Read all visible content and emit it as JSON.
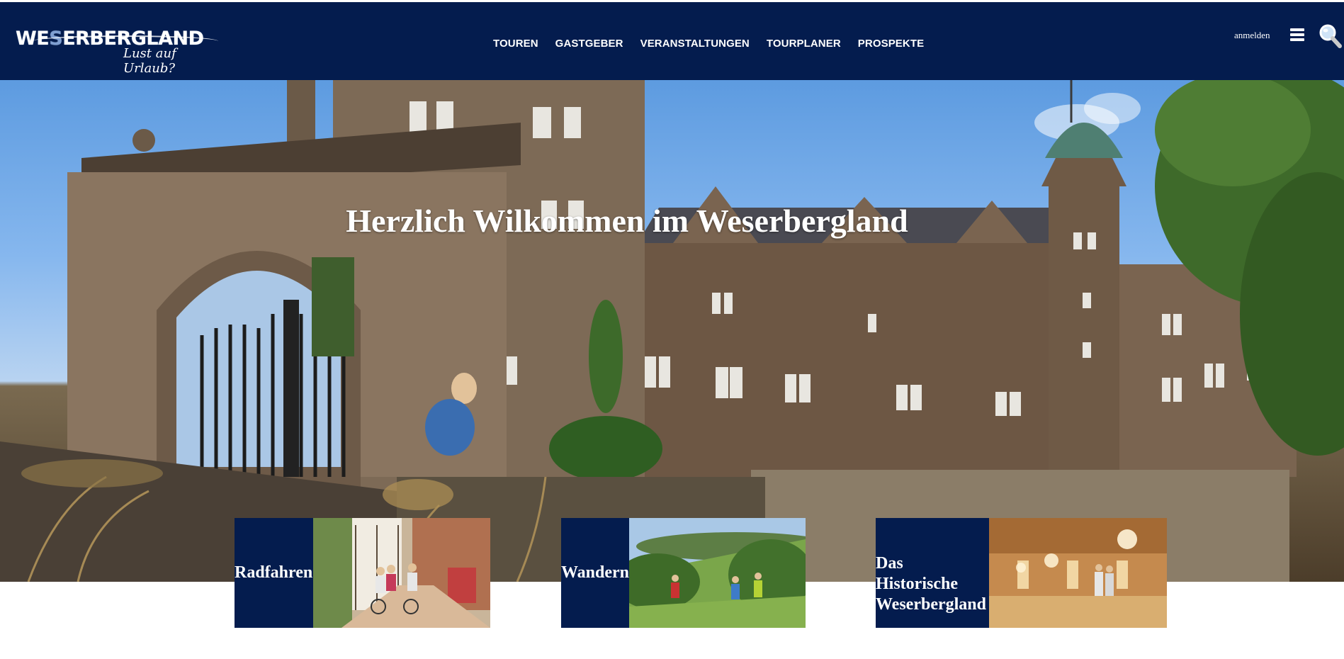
{
  "brand": {
    "name_parts": [
      "WE",
      "S",
      "ERBERGLAND"
    ],
    "tagline": "Lust auf Urlaub?"
  },
  "nav": {
    "items": [
      {
        "label": "TOUREN"
      },
      {
        "label": "GASTGEBER"
      },
      {
        "label": "VERANSTALTUNGEN"
      },
      {
        "label": "TOURPLANER"
      },
      {
        "label": "PROSPEKTE"
      }
    ]
  },
  "header": {
    "login_label": "anmelden",
    "menu_icon": "hamburger-menu-icon",
    "search_icon": "magnifier-search-icon"
  },
  "hero": {
    "title": "Herzlich Wilkommen im Weserbergland"
  },
  "tiles": [
    {
      "label": "Radfahren"
    },
    {
      "label": "Wandern"
    },
    {
      "label_lines": [
        "Das Historische",
        "Weserbergland"
      ]
    }
  ],
  "colors": {
    "header_bg": "#041c4e",
    "tile_bg": "#041c4e",
    "text_on_dark": "#ffffff"
  }
}
